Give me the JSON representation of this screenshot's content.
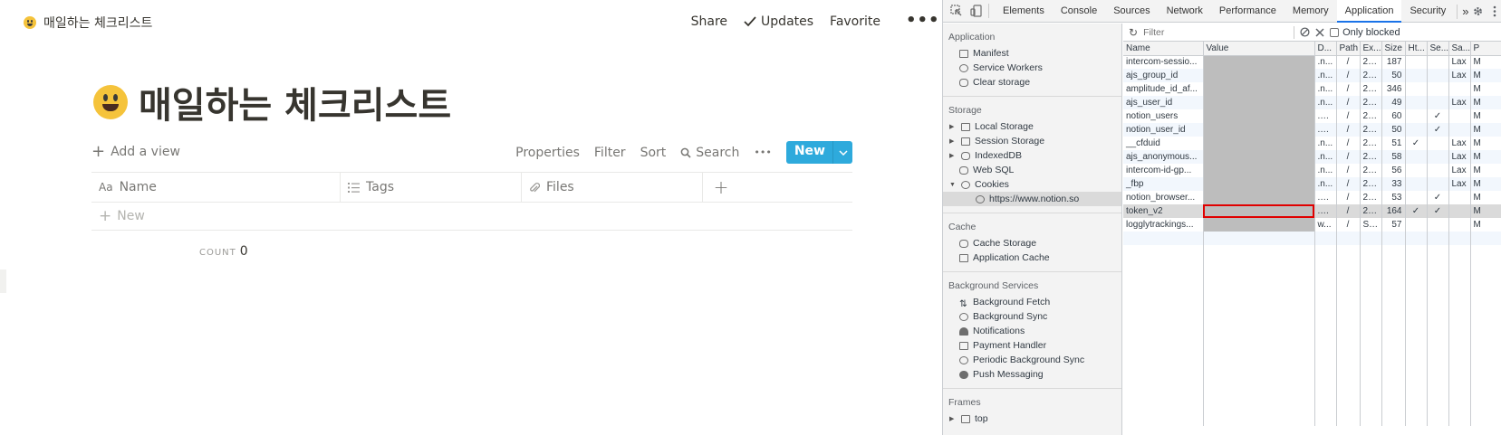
{
  "notion": {
    "breadcrumb": "매일하는 체크리스트",
    "top_actions": {
      "share": "Share",
      "updates": "Updates",
      "favorite": "Favorite",
      "more": "•••"
    },
    "title": "매일하는 체크리스트",
    "toolbar": {
      "add_view": "Add a view",
      "properties": "Properties",
      "filter": "Filter",
      "sort": "Sort",
      "search": "Search",
      "more": "•••",
      "new": "New"
    },
    "columns": {
      "name": "Name",
      "tags": "Tags",
      "files": "Files",
      "add": "+"
    },
    "new_row": "New",
    "count_label": "COUNT",
    "count_value": "0"
  },
  "devtools": {
    "tabs": [
      "Elements",
      "Console",
      "Sources",
      "Network",
      "Performance",
      "Memory",
      "Application",
      "Security"
    ],
    "active_tab": "Application",
    "more_tabs": "»",
    "sidebar": {
      "application": {
        "title": "Application",
        "items": [
          "Manifest",
          "Service Workers",
          "Clear storage"
        ]
      },
      "storage": {
        "title": "Storage",
        "items": [
          "Local Storage",
          "Session Storage",
          "IndexedDB",
          "Web SQL",
          "Cookies"
        ],
        "cookie_origin": "https://www.notion.so"
      },
      "cache": {
        "title": "Cache",
        "items": [
          "Cache Storage",
          "Application Cache"
        ]
      },
      "background": {
        "title": "Background Services",
        "items": [
          "Background Fetch",
          "Background Sync",
          "Notifications",
          "Payment Handler",
          "Periodic Background Sync",
          "Push Messaging"
        ]
      },
      "frames": {
        "title": "Frames",
        "items": [
          "top"
        ]
      }
    },
    "filter_placeholder": "Filter",
    "only_blocked": "Only blocked",
    "table_headers": [
      "Name",
      "Value",
      "D...",
      "Path",
      "Ex...",
      "Size",
      "Ht...",
      "Se...",
      "Sa...",
      "P"
    ],
    "cookies": [
      {
        "name": "intercom-sessio...",
        "domain": ".n...",
        "path": "/",
        "exp": "20...",
        "size": "187",
        "http": "",
        "secure": "",
        "same": "Lax",
        "p": "M"
      },
      {
        "name": "ajs_group_id",
        "domain": ".n...",
        "path": "/",
        "exp": "20...",
        "size": "50",
        "http": "",
        "secure": "",
        "same": "Lax",
        "p": "M"
      },
      {
        "name": "amplitude_id_af...",
        "domain": ".n...",
        "path": "/",
        "exp": "20...",
        "size": "346",
        "http": "",
        "secure": "",
        "same": "",
        "p": "M"
      },
      {
        "name": "ajs_user_id",
        "domain": ".n...",
        "path": "/",
        "exp": "20...",
        "size": "49",
        "http": "",
        "secure": "",
        "same": "Lax",
        "p": "M"
      },
      {
        "name": "notion_users",
        "domain": ".w...",
        "path": "/",
        "exp": "20...",
        "size": "60",
        "http": "",
        "secure": "✓",
        "same": "",
        "p": "M"
      },
      {
        "name": "notion_user_id",
        "domain": ".w...",
        "path": "/",
        "exp": "20...",
        "size": "50",
        "http": "",
        "secure": "✓",
        "same": "",
        "p": "M"
      },
      {
        "name": "__cfduid",
        "domain": ".n...",
        "path": "/",
        "exp": "20...",
        "size": "51",
        "http": "✓",
        "secure": "",
        "same": "Lax",
        "p": "M"
      },
      {
        "name": "ajs_anonymous...",
        "domain": ".n...",
        "path": "/",
        "exp": "20...",
        "size": "58",
        "http": "",
        "secure": "",
        "same": "Lax",
        "p": "M"
      },
      {
        "name": "intercom-id-gp...",
        "domain": ".n...",
        "path": "/",
        "exp": "20...",
        "size": "56",
        "http": "",
        "secure": "",
        "same": "Lax",
        "p": "M"
      },
      {
        "name": "_fbp",
        "domain": ".n...",
        "path": "/",
        "exp": "20...",
        "size": "33",
        "http": "",
        "secure": "",
        "same": "Lax",
        "p": "M"
      },
      {
        "name": "notion_browser...",
        "domain": ".w...",
        "path": "/",
        "exp": "20...",
        "size": "53",
        "http": "",
        "secure": "✓",
        "same": "",
        "p": "M"
      },
      {
        "name": "token_v2",
        "domain": ".w...",
        "path": "/",
        "exp": "20...",
        "size": "164",
        "http": "✓",
        "secure": "✓",
        "same": "",
        "p": "M",
        "selected": true
      },
      {
        "name": "logglytrackings...",
        "domain": "w...",
        "path": "/",
        "exp": "Se...",
        "size": "57",
        "http": "",
        "secure": "",
        "same": "",
        "p": "M"
      }
    ],
    "colors": {
      "accent": "#1a73e8",
      "highlight": "#e00000",
      "notion_button": "#2eaadc"
    }
  }
}
